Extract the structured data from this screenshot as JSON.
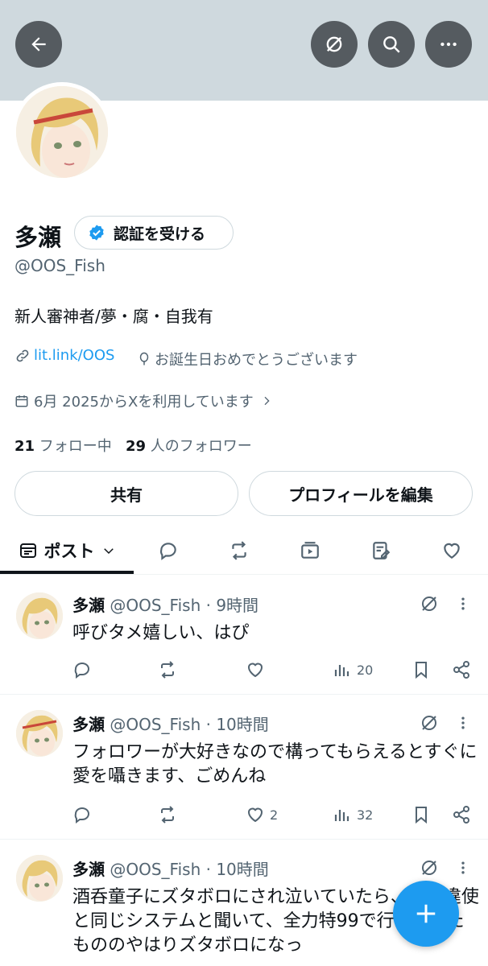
{
  "profile": {
    "name": "多瀬",
    "verify_label": "認証を受ける",
    "handle": "@OOS_Fish",
    "bio": "新人審神者/夢・腐・自我有",
    "link": "lit.link/OOS",
    "birthday": "お誕生日おめでとうございます",
    "joined": "6月 2025からXを利用しています",
    "following_count": "21",
    "following_label": "フォロー中",
    "followers_count": "29",
    "followers_label": "人のフォロワー",
    "share_label": "共有",
    "edit_label": "プロフィールを編集"
  },
  "tabs": {
    "posts_label": "ポスト"
  },
  "posts": [
    {
      "name": "多瀬",
      "meta": "@OOS_Fish · 9時間",
      "text": "呼びタメ嬉しい、はぴ",
      "likes": "",
      "views": "20"
    },
    {
      "name": "多瀬",
      "meta": "@OOS_Fish · 10時間",
      "text": "フォロワーが大好きなので構ってもらえるとすぐに愛を囁きます、ごめんね",
      "likes": "2",
      "views": "32"
    },
    {
      "name": "多瀬",
      "meta": "@OOS_Fish · 10時間",
      "text": "酒呑童子にズタボロにされ泣いていたら、検非違使と同じシステムと聞いて、全力特99で行ってみたもののやはりズタボロになっ",
      "likes": "",
      "views": ""
    }
  ],
  "colors": {
    "accent": "#1d9bf0",
    "banner": "#cfd9de",
    "secondary_text": "#536471"
  }
}
